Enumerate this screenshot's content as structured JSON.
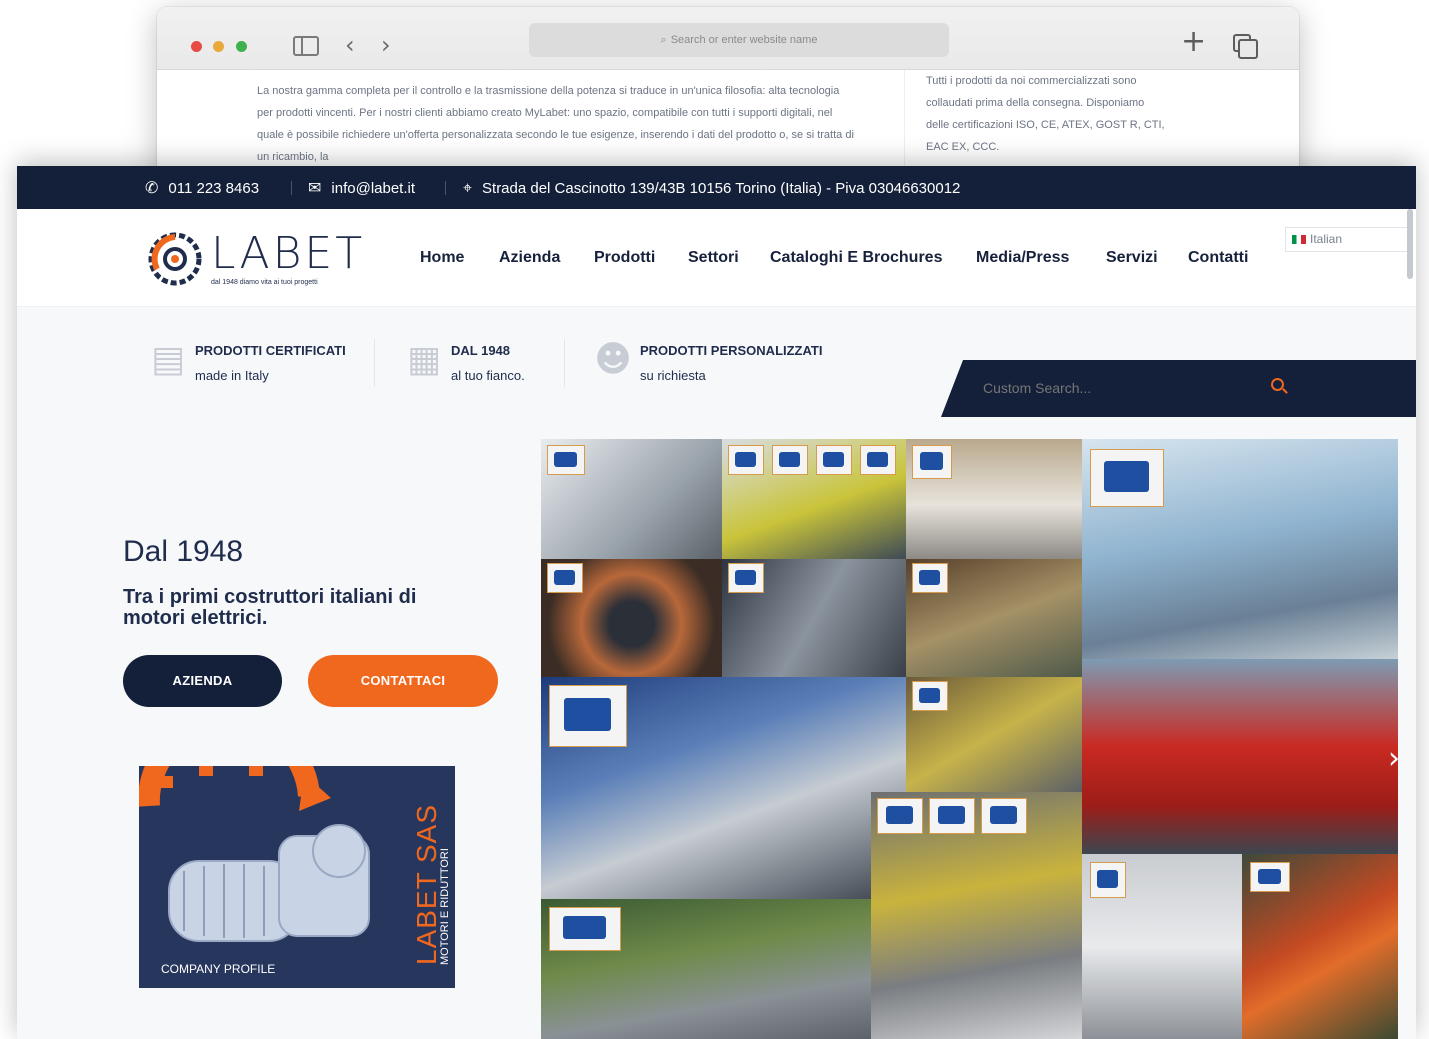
{
  "browser": {
    "search_placeholder": "Search or enter website name",
    "back_page": {
      "paragraph_left": "La nostra gamma completa per il controllo e la trasmissione della potenza si traduce in un'unica filosofia: alta tecnologia per prodotti vincenti. Per i nostri clienti abbiamo creato MyLabet: uno spazio, compatibile con tutti i supporti digitali, nel quale è possibile richiedere un'offerta personalizzata secondo le tue esigenze, inserendo i dati del prodotto o, se si tratta di un ricambio, la",
      "paragraph_right": "Tutti i prodotti da noi commercializzati sono collaudati prima della consegna. Disponiamo delle certificazioni ISO, CE, ATEX, GOST R, CTI, EAC EX, CCC."
    }
  },
  "topbar": {
    "phone": "011 223 8463",
    "email": "info@labet.it",
    "address": "Strada del Cascinotto 139/43B 10156 Torino (Italia) - Piva 03046630012"
  },
  "logo": {
    "word": "LABET",
    "tagline": "dal 1948 diamo vita ai tuoi progetti"
  },
  "nav": {
    "items": [
      "Home",
      "Azienda",
      "Prodotti",
      "Settori",
      "Cataloghi E Brochures",
      "Media/Press",
      "Servizi",
      "Contatti"
    ]
  },
  "language": {
    "selected": "Italian"
  },
  "features": [
    {
      "title": "PRODOTTI CERTIFICATI",
      "sub": "made in Italy",
      "icon": "certificate-icon"
    },
    {
      "title": "DAL 1948",
      "sub": "al tuo fianco.",
      "icon": "building-icon"
    },
    {
      "title": "PRODOTTI PERSONALIZZATI",
      "sub": "su richiesta",
      "icon": "worker-icon"
    }
  ],
  "search": {
    "placeholder": "Custom Search..."
  },
  "hero": {
    "year": "Dal 1948",
    "subtitle": "Tra i primi costruttori italiani di motori elettrici.",
    "btn_azienda": "AZIENDA",
    "btn_contattaci": "CONTATTACI"
  },
  "profile": {
    "title": "LABET SAS",
    "subtitle": "MOTORI E RIDUTTORI",
    "caption": "COMPANY PROFILE"
  },
  "colors": {
    "navy": "#14203a",
    "orange": "#f0671e",
    "text_dark": "#1f2c4c"
  }
}
